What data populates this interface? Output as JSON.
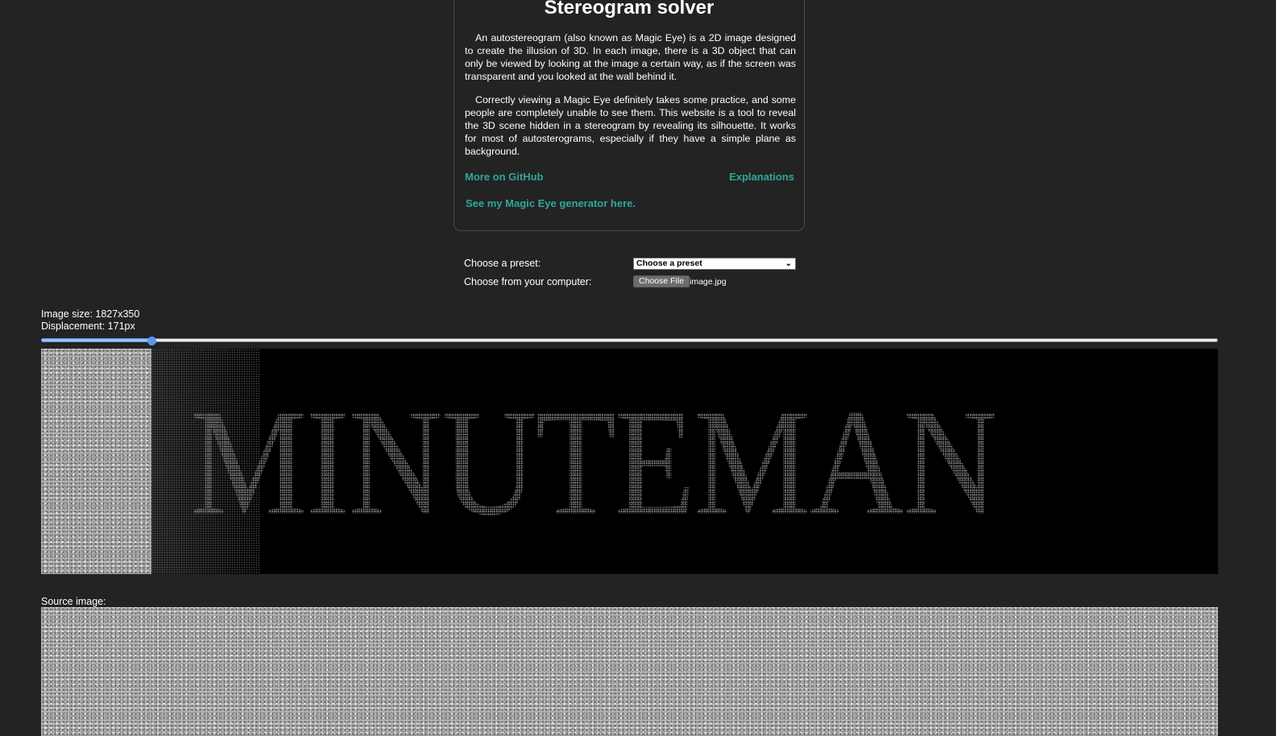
{
  "intro": {
    "title": "Stereogram solver",
    "paragraph1": "An autostereogram (also known as Magic Eye) is a 2D image designed to create the illusion of 3D. In each image, there is a 3D object that can only be viewed by looking at the image a certain way, as if the screen was transparent and you looked at the wall behind it.",
    "paragraph2": "Correctly viewing a Magic Eye definitely takes some practice, and some people are completely unable to see them. This website is a tool to reveal the 3D scene hidden in a stereogram by revealing its silhouette. It works for most of autosterograms, especially if they have a simple plane as background.",
    "link_github": "More on GitHub",
    "link_explanations": "Explanations",
    "link_generator": "See my Magic Eye generator here."
  },
  "controls": {
    "preset_label": "Choose a preset:",
    "preset_value": "Choose a preset",
    "preset_icon": "chevron-down-icon",
    "file_label": "Choose from your computer:",
    "file_button": "Choose File",
    "file_name": "image.jpg"
  },
  "info": {
    "size": "Image size: 1827x350",
    "displacement": "Displacement: 171px"
  },
  "slider": {
    "value": 171,
    "min": 0,
    "max": 1827
  },
  "result": {
    "text": "MINUTEMAN"
  },
  "source": {
    "label": "Source image:"
  },
  "colors": {
    "background": "#232323",
    "link": "#2fa89a",
    "slider_accent": "#5a98ee"
  }
}
